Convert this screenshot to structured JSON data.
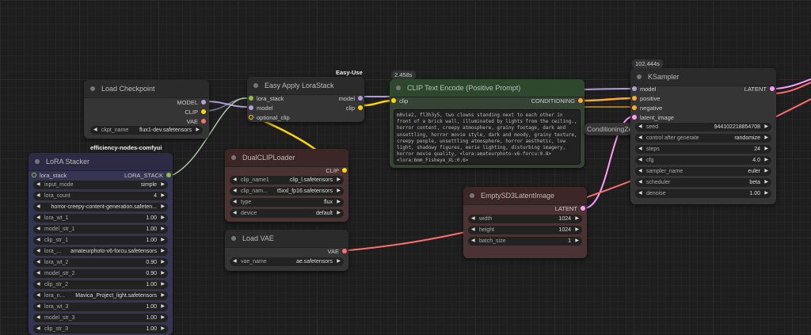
{
  "load_checkpoint": {
    "title": "Load Checkpoint",
    "outputs": [
      "MODEL",
      "CLIP",
      "VAE"
    ],
    "ckpt_label": "ckpt_name",
    "ckpt_value": "flux1-dev.safetensors",
    "footer_tag": "efficiency-nodes-comfyui"
  },
  "lora_stack_apply": {
    "title": "Easy Apply LoraStack",
    "badge": "Easy-Use",
    "inputs": [
      "lora_stack",
      "model",
      "optional_clip"
    ],
    "outputs": [
      "model",
      "clip"
    ]
  },
  "clip_encode": {
    "title": "CLIP Text Encode (Positive Prompt)",
    "time": "2.458s",
    "input": "clip",
    "output": "CONDITIONING",
    "text": "m0vie2, fl3h3y5, two clowns standing next to each other in front of a brick wall, illuminated by lights from the ceiling., horror content, creepy atmosphere, grainy footage, dark and unsettling, horror movie style, dark and moody, grainy texture, creepy people, unsettling atmosphere, horror aesthetic, low light, shadowy figures, eerie lighting, disturbing imagery, horror movie quality, <lora:amateurphoto-v6-forcu:0.8> <lora:6mm_Fisheye_XL:0.6>"
  },
  "ksampler": {
    "title": "KSampler",
    "time": "102.444s",
    "inputs": [
      "model",
      "positive",
      "negative",
      "latent_image"
    ],
    "output": "LATENT",
    "widgets": [
      {
        "label": "seed",
        "value": "944102218854708"
      },
      {
        "label": "control after generate",
        "value": "randomize"
      },
      {
        "label": "steps",
        "value": "24"
      },
      {
        "label": "cfg",
        "value": "4.0"
      },
      {
        "label": "sampler_name",
        "value": "euler"
      },
      {
        "label": "scheduler",
        "value": "beta"
      },
      {
        "label": "denoise",
        "value": "1.00"
      }
    ]
  },
  "conditioning_zero": {
    "label": "ConditioningZe"
  },
  "dual_clip": {
    "title": "DualCLIPLoader",
    "output": "CLIP",
    "widgets": [
      {
        "label": "clip_name1",
        "value": "clip_l.safetensors"
      },
      {
        "label": "clip_nam...",
        "value": "t5xxl_fp16.safetensors"
      },
      {
        "label": "type",
        "value": "flux"
      },
      {
        "label": "device",
        "value": "default"
      }
    ]
  },
  "empty_latent": {
    "title": "EmptySD3LatentImage",
    "output": "LATENT",
    "widgets": [
      {
        "label": "width",
        "value": "1024"
      },
      {
        "label": "height",
        "value": "1024"
      },
      {
        "label": "batch_size",
        "value": "1"
      }
    ]
  },
  "load_vae": {
    "title": "Load VAE",
    "output": "VAE",
    "vae_label": "vae_name",
    "vae_value": "ae.safetensors"
  },
  "lora_stacker": {
    "title": "LoRA Stacker",
    "input": "lora_stack",
    "output": "LORA_STACK",
    "widgets": [
      {
        "label": "input_mode",
        "value": "simple"
      },
      {
        "label": "lora_count",
        "value": "4"
      },
      {
        "label": "",
        "value": "horror-creepy-content-generation.safeten..."
      },
      {
        "label": "lora_wt_1",
        "value": "1.00"
      },
      {
        "label": "model_str_1",
        "value": "1.00"
      },
      {
        "label": "clip_str_1",
        "value": "1.00"
      },
      {
        "label": "lora_...",
        "value": "amateurphoto-v6-forcu.safetensors"
      },
      {
        "label": "lora_wt_2",
        "value": "0.90"
      },
      {
        "label": "model_str_2",
        "value": "0.90"
      },
      {
        "label": "clip_str_2",
        "value": "1.00"
      },
      {
        "label": "lora_n...",
        "value": "Mavica_Project_light.safetensors"
      },
      {
        "label": "lora_wt_3",
        "value": "1.00"
      },
      {
        "label": "model_str_3",
        "value": "1.00"
      },
      {
        "label": "clip_str_3",
        "value": "1.00"
      }
    ]
  },
  "colors": {
    "model": "#b39ddb",
    "clip": "#ffd500",
    "vae": "#ff6e6e",
    "conditioning": "#ffa931",
    "latent": "#ff9cf9",
    "lora_stack": "#8bc34a"
  }
}
